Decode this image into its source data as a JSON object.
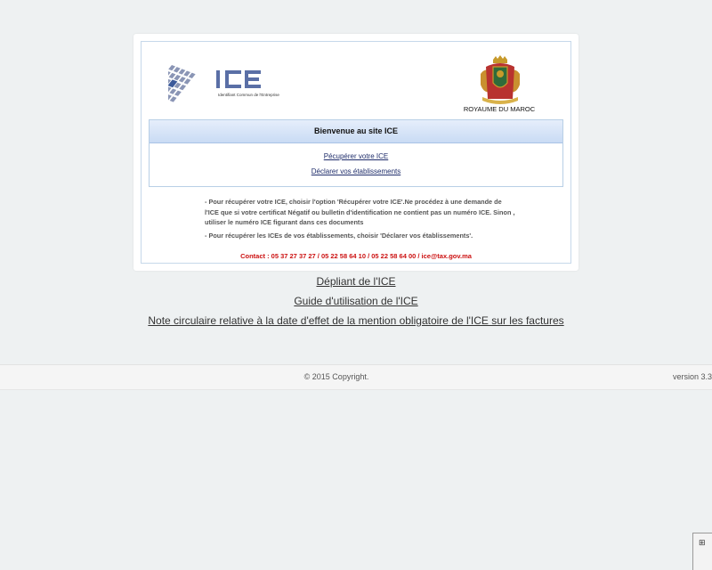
{
  "header": {
    "logo_text": "ICE",
    "logo_tagline": "Identifiant Commun de l'Entreprise",
    "royaume_label": "ROYAUME DU MAROC"
  },
  "welcome": {
    "title": "Bienvenue au site ICE",
    "link_recuperer": "Pécupérer votre ICE",
    "link_declarer": "Déclarer vos établissements"
  },
  "info": {
    "paragraph_1": "- Pour récupérer votre ICE, choisir l'option 'Récupérer votre ICE'.Ne procédez à une demande de l'ICE que si votre certificat Négatif ou bulletin d'identification ne contient pas un numéro ICE. Sinon , utiliser le numéro ICE figurant dans ces documents",
    "paragraph_2": "- Pour récupérer les ICEs de vos établissements, choisir 'Déclarer vos établissements'.",
    "contact": "Contact : 05 37 27 37 27 / 05 22 58 64 10 / 05 22 58 64 00 / ice@tax.gov.ma"
  },
  "documents": {
    "depliant": "Dépliant de l'ICE",
    "guide": "Guide d'utilisation de l'ICE",
    "note": "Note circulaire relative à la date d'effet de la mention obligatoire de l'ICE sur les factures"
  },
  "footer": {
    "copyright": "© 2015 Copyright.",
    "version": "version 3.3"
  },
  "colors": {
    "accent_red": "#cc1111",
    "logo_blue": "#5a6fa6",
    "header_gradient_bottom": "#c9dbf4",
    "border_blue": "#b8cfe6"
  },
  "icons": {
    "logo_grid": "ice-grid-icon",
    "emblem": "moroccan-coat-of-arms-icon"
  }
}
